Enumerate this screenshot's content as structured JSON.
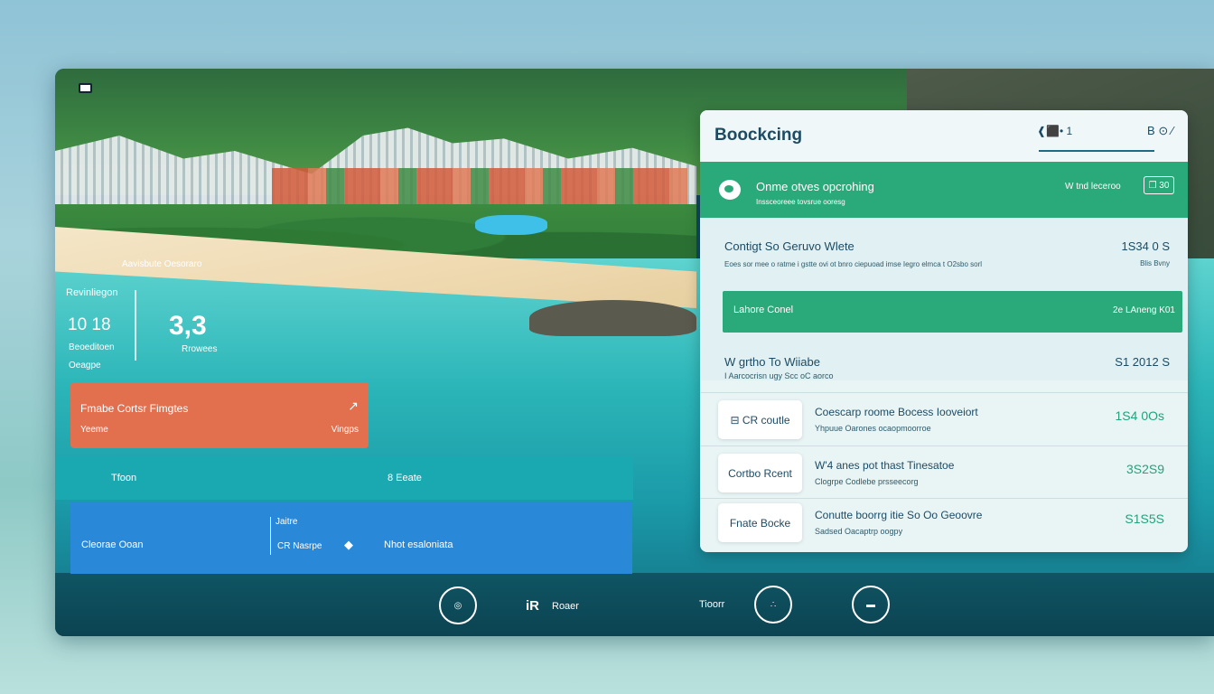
{
  "hero": {
    "beach_caption": "Aavisbute Oesoraro",
    "stats": {
      "label_top": "Revinliegon",
      "value_left": "10  18",
      "label_bottom_1": "Beoeditoen",
      "label_bottom_2": "Oeagpe",
      "value_big": "3,3",
      "value_big_caption": "Rrowees"
    }
  },
  "promo_card": {
    "title": "Fmabe Cortsr Fimgtes",
    "subtitle": "Yeeme",
    "right_label": "Vingps",
    "icon_glyph": "↗"
  },
  "teal_band": {
    "left": "Tfoon",
    "right": "8 Eeate"
  },
  "blue_band": {
    "left": "Cleorae Ooan",
    "mid_top": "Jaitre",
    "mid_bottom": "CR Nasrpe",
    "icon_glyph": "◆",
    "right": "Nhot esaloniata"
  },
  "bottom_nav": {
    "btn1": "◎",
    "item2_icon": "iR",
    "item2_label": "Roaer",
    "item3_label": "Tioorr",
    "btn3": "∴",
    "btn4": "▬"
  },
  "booking": {
    "title": "Boockcing",
    "header_mid": "❰⬛• 1",
    "header_right": "B ⊙ ⁄",
    "green_header": {
      "title": "Onme otves opcrohing",
      "subtitle": "Inssceoreee tovsrue ooresg",
      "right_label": "W tnd leceroo",
      "icon_text": "❐ 30"
    },
    "summary": {
      "title": "Contigt So Geruvo Wlete",
      "desc": "Eoes sor mee o ratme i gstte ovi ot bnro ciepuoad imse Iegro elmca t O2sbo sorl",
      "price": "1S34 0 S",
      "price_sub": "Blis Bvny",
      "bar_left": "Lahore Conel",
      "bar_right": "2e LAneng K01",
      "title2": "W grtho To Wiiabe",
      "desc2": "I Aarcocrisn ugy Scc oC aorco",
      "price2": "S1 2012 S"
    },
    "items": [
      {
        "tag": "⊟ CR coutle",
        "title": "Coescarp roome Bocess Iooveiort",
        "desc": "Yhpuue Oarones ocaopmoorroe",
        "price": "1S4 0Os"
      },
      {
        "tag": "Cortbo Rcent",
        "title": "W'4 anes pot thast Tinesatoe",
        "desc": "Clogrpe Codlebe prsseecorg",
        "price": "3S2S9"
      },
      {
        "tag": "Fnate Bocke",
        "title": "Conutte boorrg itie So Oo Geoovre",
        "desc": "Sadsed Oacaptrp oogpy",
        "price": "S1S5S"
      }
    ]
  },
  "colors": {
    "accent_green": "#2aa97a",
    "accent_orange": "#e2704e",
    "accent_blue": "#2a88d8",
    "teal": "#1aa9b1"
  }
}
